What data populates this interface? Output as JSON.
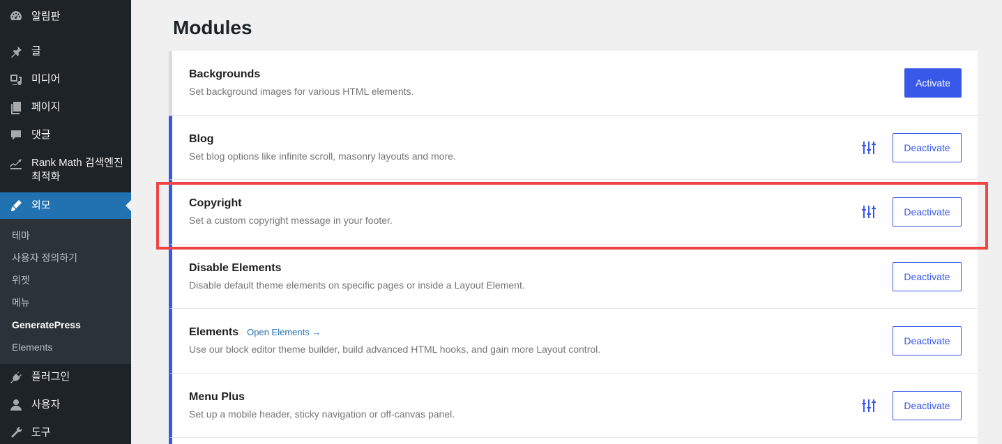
{
  "sidebar": {
    "items": [
      {
        "label": "알림판",
        "icon": "dashboard-icon"
      },
      {
        "label": "글",
        "icon": "pin-icon"
      },
      {
        "label": "미디어",
        "icon": "media-icon"
      },
      {
        "label": "페이지",
        "icon": "pages-icon"
      },
      {
        "label": "댓글",
        "icon": "comments-icon"
      },
      {
        "label": "Rank Math 검색엔진 최적화",
        "icon": "rank-math-icon"
      },
      {
        "label": "외모",
        "icon": "appearance-icon"
      }
    ],
    "submenu": [
      "테마",
      "사용자 정의하기",
      "위젯",
      "메뉴",
      "GeneratePress",
      "Elements"
    ],
    "bottom_items": [
      {
        "label": "플러그인",
        "icon": "plugins-icon"
      },
      {
        "label": "사용자",
        "icon": "users-icon"
      },
      {
        "label": "도구",
        "icon": "tools-icon"
      }
    ]
  },
  "main": {
    "title": "Modules",
    "modules": [
      {
        "name": "Backgrounds",
        "description": "Set background images for various HTML elements.",
        "button": "Activate",
        "active": false,
        "has_settings": false,
        "link": ""
      },
      {
        "name": "Blog",
        "description": "Set blog options like infinite scroll, masonry layouts and more.",
        "button": "Deactivate",
        "active": true,
        "has_settings": true,
        "link": ""
      },
      {
        "name": "Copyright",
        "description": "Set a custom copyright message in your footer.",
        "button": "Deactivate",
        "active": true,
        "has_settings": true,
        "link": ""
      },
      {
        "name": "Disable Elements",
        "description": "Disable default theme elements on specific pages or inside a Layout Element.",
        "button": "Deactivate",
        "active": true,
        "has_settings": false,
        "link": ""
      },
      {
        "name": "Elements",
        "description": "Use our block editor theme builder, build advanced HTML hooks, and gain more Layout control.",
        "button": "Deactivate",
        "active": true,
        "has_settings": false,
        "link": "Open Elements →"
      },
      {
        "name": "Menu Plus",
        "description": "Set up a mobile header, sticky navigation or off-canvas panel.",
        "button": "Deactivate",
        "active": true,
        "has_settings": true,
        "link": ""
      }
    ]
  },
  "colors": {
    "accent": "#3858e9",
    "sidebar_bg": "#1d2327",
    "highlight": "#ef4444",
    "current_menu": "#2271b1"
  }
}
